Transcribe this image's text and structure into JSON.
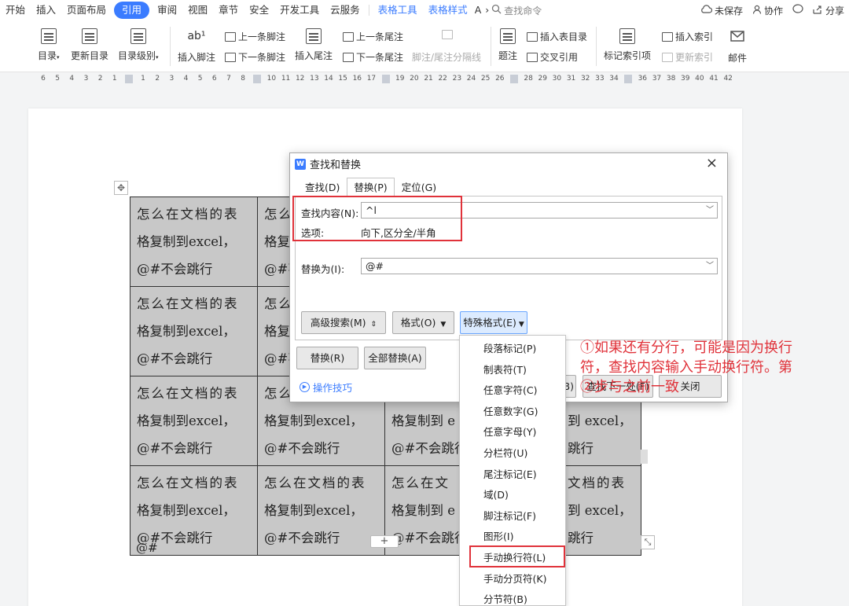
{
  "menubar": {
    "items": [
      "开始",
      "插入",
      "页面布局",
      "引用",
      "审阅",
      "视图",
      "章节",
      "安全",
      "开发工具",
      "云服务"
    ],
    "active_index": 3,
    "context_tabs": [
      "表格工具",
      "表格样式",
      "A"
    ],
    "more_glyph": "›",
    "search_placeholder": "查找命令",
    "unsaved": "未保存",
    "collaborate": "协作",
    "share": "分享"
  },
  "ribbon": {
    "toc": "目录",
    "update_toc": "更新目录",
    "toc_level": "目录级别",
    "insert_footnote": "插入脚注",
    "prev_footnote": "上一条脚注",
    "next_footnote": "下一条脚注",
    "insert_endnote": "插入尾注",
    "prev_endnote": "上一条尾注",
    "next_endnote": "下一条尾注",
    "separator": "脚注/尾注分隔线",
    "caption": "题注",
    "insert_table_of_figures": "插入表目录",
    "cross_reference": "交叉引用",
    "mark_index": "标记索引项",
    "insert_index": "插入索引",
    "update_index": "更新索引",
    "mail": "邮件",
    "footnote_glyph": "ab¹"
  },
  "ruler": {
    "ticks": [
      "6",
      "5",
      "4",
      "3",
      "2",
      "1",
      "",
      "1",
      "2",
      "3",
      "4",
      "5",
      "6",
      "7",
      "8",
      "",
      "10",
      "11",
      "12",
      "13",
      "14",
      "15",
      "16",
      "17",
      "",
      "19",
      "20",
      "21",
      "22",
      "23",
      "24",
      "25",
      "26",
      "",
      "28",
      "29",
      "30",
      "31",
      "32",
      "33",
      "34",
      "",
      "36",
      "37",
      "38",
      "39",
      "40",
      "41",
      "42"
    ]
  },
  "document": {
    "table": {
      "line1": "怎么在文档的表",
      "line2": "格复制到excel，",
      "line3": "@#不会跳行",
      "line1_col3_cut": "怎么在文",
      "line2_col3_cut": "格复制到 e",
      "line1_col4_cut": "文档的表",
      "line2_col4_cut": "到 excel，",
      "line3_col4_cut": "跳行",
      "line1_col2_cut": "怎么",
      "line2_col2_cut": "格复",
      "line3_col2_cut": "@#不"
    },
    "after_table_text": "@#"
  },
  "dialog": {
    "title": "查找和替换",
    "logo": "W",
    "close": "×",
    "tabs": [
      "查找(D)",
      "替换(P)",
      "定位(G)"
    ],
    "active_tab": 1,
    "find_label": "查找内容(N):",
    "find_value": "^l",
    "options_label": "选项:",
    "options_value": "向下,区分全/半角",
    "replace_label": "替换为(I):",
    "replace_value": "@#",
    "btn_advanced": "高级搜索(M)",
    "btn_format": "格式(O)",
    "btn_special": "特殊格式(E)",
    "btn_replace": "替换(R)",
    "btn_replace_all": "全部替换(A)",
    "btn_find_prev_cut": "(B)",
    "btn_find_next": "查找下一处(F)",
    "btn_close": "关闭",
    "tips": "操作技巧"
  },
  "special_menu": {
    "items": [
      "段落标记(P)",
      "制表符(T)",
      "任意字符(C)",
      "任意数字(G)",
      "任意字母(Y)",
      "分栏符(U)",
      "尾注标记(E)",
      "域(D)",
      "脚注标记(F)",
      "图形(I)",
      "手动换行符(L)",
      "手动分页符(K)",
      "分节符(B)"
    ],
    "highlighted_index": 10
  },
  "annotation": {
    "line1": "①如果还有分行，可能是因为换行",
    "line2": "符，查找内容输入手动换行符。第",
    "line3": "②步与之前一致",
    "color": "#e0323a"
  }
}
